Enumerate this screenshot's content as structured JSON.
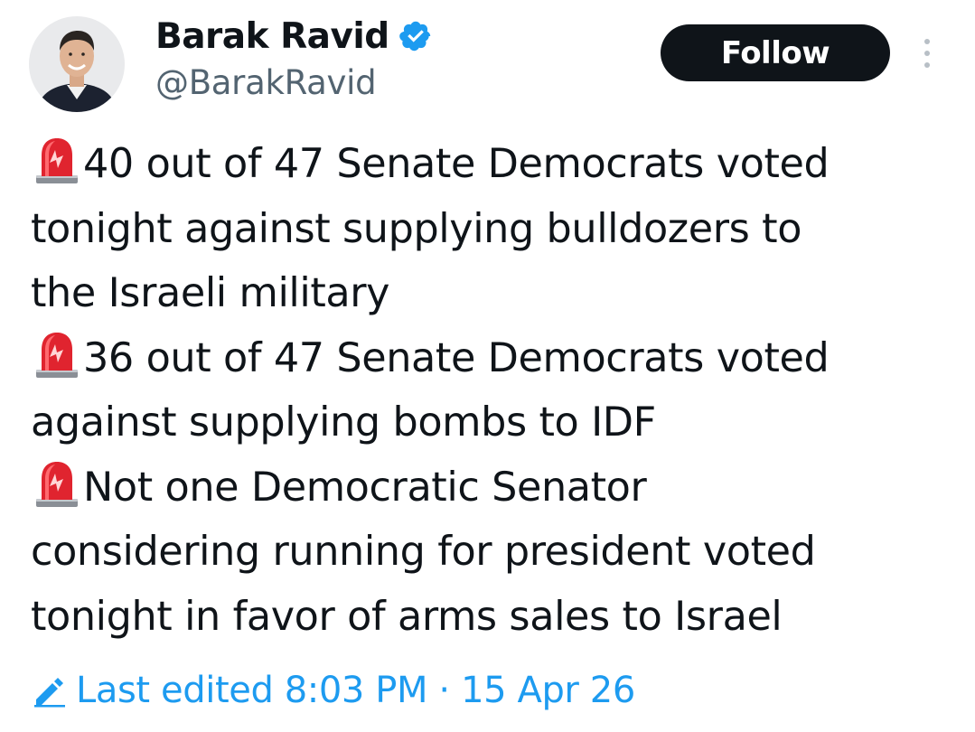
{
  "author": {
    "display_name": "Barak Ravid",
    "handle": "@BarakRavid",
    "verified": true
  },
  "actions": {
    "follow_label": "Follow"
  },
  "tweet": {
    "lines": [
      "40 out of 47 Senate Democrats voted",
      "tonight against supplying bulldozers to",
      "the Israeli military",
      "36 out of 47 Senate Democrats voted",
      "against supplying bombs to IDF",
      "Not one Democratic Senator",
      "considering running for president voted",
      "tonight in favor of arms sales to Israel"
    ],
    "bullet_icon": "rotating-light-siren-icon"
  },
  "edit_info": {
    "text": "Last edited 8:03 PM · 15 Apr 26"
  },
  "colors": {
    "text_primary": "#0f1419",
    "text_secondary": "#536471",
    "accent": "#1d9bf0",
    "follow_bg": "#0f1419",
    "background": "#ffffff"
  },
  "icons": {
    "verified": "verified-badge-icon",
    "more": "more-vertical-icon",
    "edit": "pencil-icon"
  }
}
